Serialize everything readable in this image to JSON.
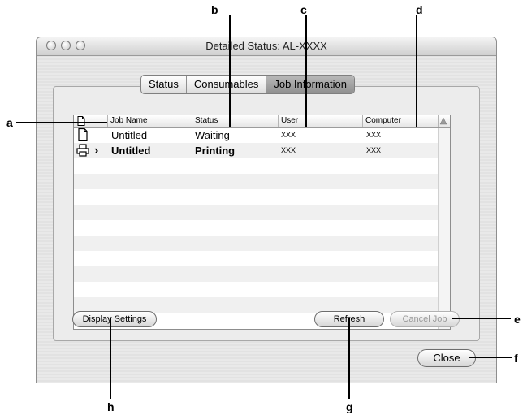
{
  "window": {
    "title": "Detailed Status: AL-XXXX"
  },
  "tabs": [
    {
      "label": "Status",
      "selected": false
    },
    {
      "label": "Consumables",
      "selected": false
    },
    {
      "label": "Job Information",
      "selected": true
    }
  ],
  "table": {
    "columns": [
      "Job Name",
      "Status",
      "User",
      "Computer"
    ],
    "rows": [
      {
        "icon": "document-icon",
        "job_name": "Untitled",
        "status": "Waiting",
        "user": "XXX",
        "computer": "XXX",
        "active": false
      },
      {
        "icon": "printer-icon",
        "marker": "›",
        "job_name": "Untitled",
        "status": "Printing",
        "user": "XXX",
        "computer": "XXX",
        "active": true
      }
    ]
  },
  "buttons": {
    "display_settings": "Display Settings",
    "refresh": "Refresh",
    "cancel_job": "Cancel Job",
    "close": "Close"
  },
  "callouts": {
    "a": "a",
    "b": "b",
    "c": "c",
    "d": "d",
    "e": "e",
    "f": "f",
    "g": "g",
    "h": "h"
  }
}
